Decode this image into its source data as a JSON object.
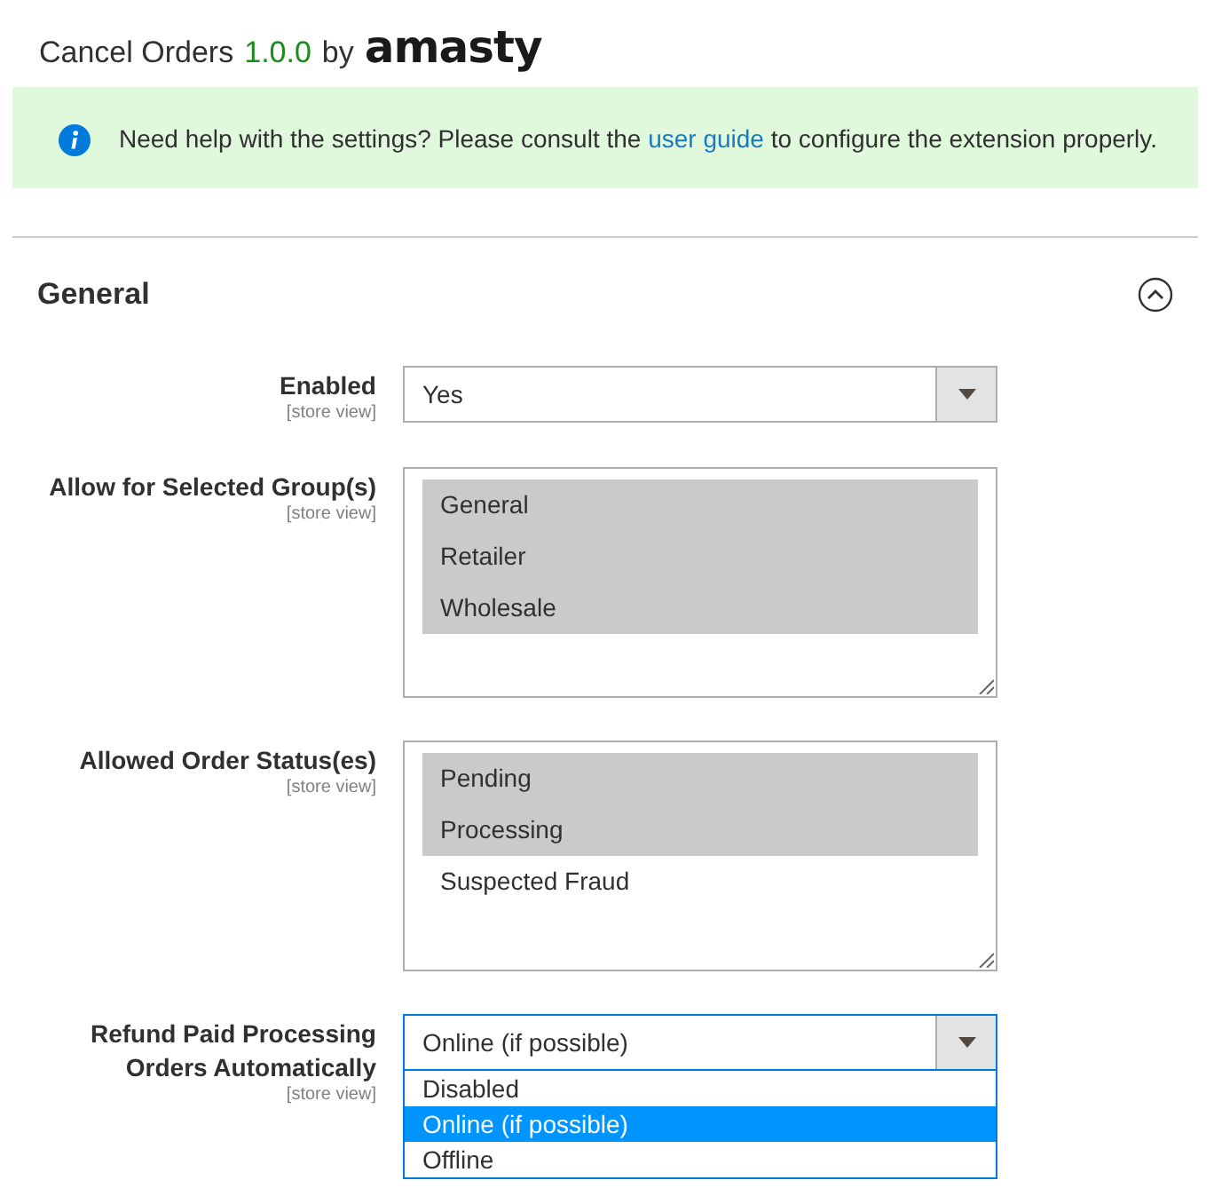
{
  "header": {
    "title": "Cancel Orders",
    "version": "1.0.0",
    "by": "by",
    "brand": "amasty"
  },
  "notice": {
    "text_before": "Need help with the settings? Please consult the",
    "link": "user guide",
    "text_after": "to configure the extension properly."
  },
  "section": {
    "title": "General",
    "expanded": true
  },
  "fields": [
    {
      "kind": "select",
      "label": "Enabled",
      "scope": "[store view]",
      "value": "Yes",
      "open": false
    },
    {
      "kind": "multiselect",
      "label": "Allow for Selected Group(s)",
      "scope": "[store view]",
      "options": [
        {
          "label": "General",
          "selected": true
        },
        {
          "label": "Retailer",
          "selected": true
        },
        {
          "label": "Wholesale",
          "selected": true
        }
      ]
    },
    {
      "kind": "multiselect",
      "label": "Allowed Order Status(es)",
      "scope": "[store view]",
      "options": [
        {
          "label": "Pending",
          "selected": true
        },
        {
          "label": "Processing",
          "selected": true
        },
        {
          "label": "Suspected Fraud",
          "selected": false
        }
      ]
    },
    {
      "kind": "select",
      "label": "Refund Paid Processing Orders Automatically",
      "scope": "[store view]",
      "value": "Online (if possible)",
      "open": true,
      "options": [
        {
          "label": "Disabled",
          "selected": false
        },
        {
          "label": "Online (if possible)",
          "selected": true
        },
        {
          "label": "Offline",
          "selected": false
        }
      ]
    }
  ]
}
